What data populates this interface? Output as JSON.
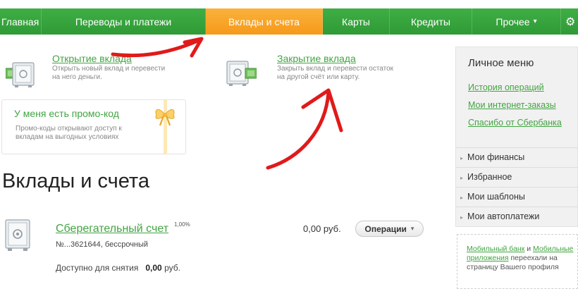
{
  "nav": {
    "items": [
      {
        "label": "Главная"
      },
      {
        "label": "Переводы и платежи"
      },
      {
        "label": "Вклады и счета"
      },
      {
        "label": "Карты"
      },
      {
        "label": "Кредиты"
      },
      {
        "label": "Прочее"
      }
    ],
    "more_caret": "▾",
    "settings_icon": "⚙"
  },
  "services": {
    "open": {
      "title": "Открытие вклада",
      "desc": "Открыть новый вклад и перевести на него деньги."
    },
    "close": {
      "title": "Закрытие вклада",
      "desc": "Закрыть вклад и перевести остаток на другой счёт или карту."
    }
  },
  "promo": {
    "title": "У меня есть промо-код",
    "desc": "Промо-коды открывают доступ к вкладам на выгодных условиях"
  },
  "section_title": "Вклады и счета",
  "account": {
    "name": "Сберегательный счет",
    "rate": "1,00%",
    "number_line": "№...3621644, бессрочный",
    "balance": "0,00 руб.",
    "available_label": "Доступно для снятия",
    "available_value": "0,00",
    "available_currency": "руб.",
    "operations_label": "Операции",
    "operations_caret": "▾"
  },
  "personal_menu": {
    "title": "Личное меню",
    "links": [
      "История операций",
      "Мои интернет-заказы",
      "Спасибо от Сбербанка"
    ],
    "sections": [
      "Мои финансы",
      "Избранное",
      "Мои шаблоны",
      "Мои автоплатежи"
    ],
    "section_marker": "▸"
  },
  "mobile_note": {
    "link1": "Мобильный банк",
    "and": " и ",
    "link2": "Мобильные приложения",
    "rest": " переехали на страницу Вашего профиля"
  },
  "colors": {
    "nav_green": "#2f9a36",
    "nav_active_orange": "#f59a1a",
    "link_green": "#42a442",
    "annotation_red": "#e01a1a"
  }
}
